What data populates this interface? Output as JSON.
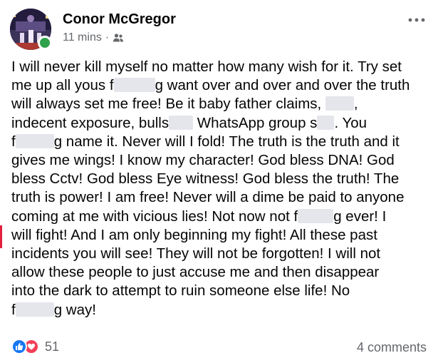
{
  "post": {
    "author": "Conor McGregor",
    "time": "11 mins",
    "separator": "·",
    "audience_icon": "friends-icon",
    "more_icon": "more-horizontal-icon",
    "body_lines": [
      [
        "I will never kill myself no matter how many wish for it. Try set"
      ],
      [
        "me up all yous f",
        {
          "redact": 58
        },
        "g want over and over and over the truth"
      ],
      [
        "will always set me free! Be it baby father claims, ",
        {
          "redact": 40
        },
        ","
      ],
      [
        "indecent exposure, bulls",
        {
          "redact": 34
        },
        " WhatsApp group s",
        {
          "redact": 24
        },
        ". You"
      ],
      [
        "f",
        {
          "redact": 54
        },
        "g name it. Never will I fold! The truth is the truth and it"
      ],
      [
        "gives me wings! I know my character! God bless DNA! God"
      ],
      [
        "bless Cctv! God bless Eye witness! God bless the truth! The"
      ],
      [
        "truth is power! I am free! Never will a dime be paid to anyone"
      ],
      [
        "coming at me with vicious lies! Not now not f",
        {
          "redact": 50
        },
        "g ever! I"
      ],
      [
        "will fight! And I am only beginning my fight! All these past"
      ],
      [
        "incidents you will see! They will not be forgotten! I will not"
      ],
      [
        "allow these people to just accuse me and then disappear"
      ],
      [
        "into the dark to attempt to ruin someone else life! No"
      ],
      [
        "f",
        {
          "redact": 54
        },
        "g way!"
      ]
    ]
  },
  "footer": {
    "reaction_icons": [
      "like-icon",
      "love-icon"
    ],
    "reaction_count": "51",
    "comments": "4 comments"
  },
  "colors": {
    "text": "#050505",
    "secondary": "#65676b",
    "like": "#1877f2",
    "love": "#f33e58",
    "online": "#31a24c",
    "redaction": "#e4e6eb"
  }
}
